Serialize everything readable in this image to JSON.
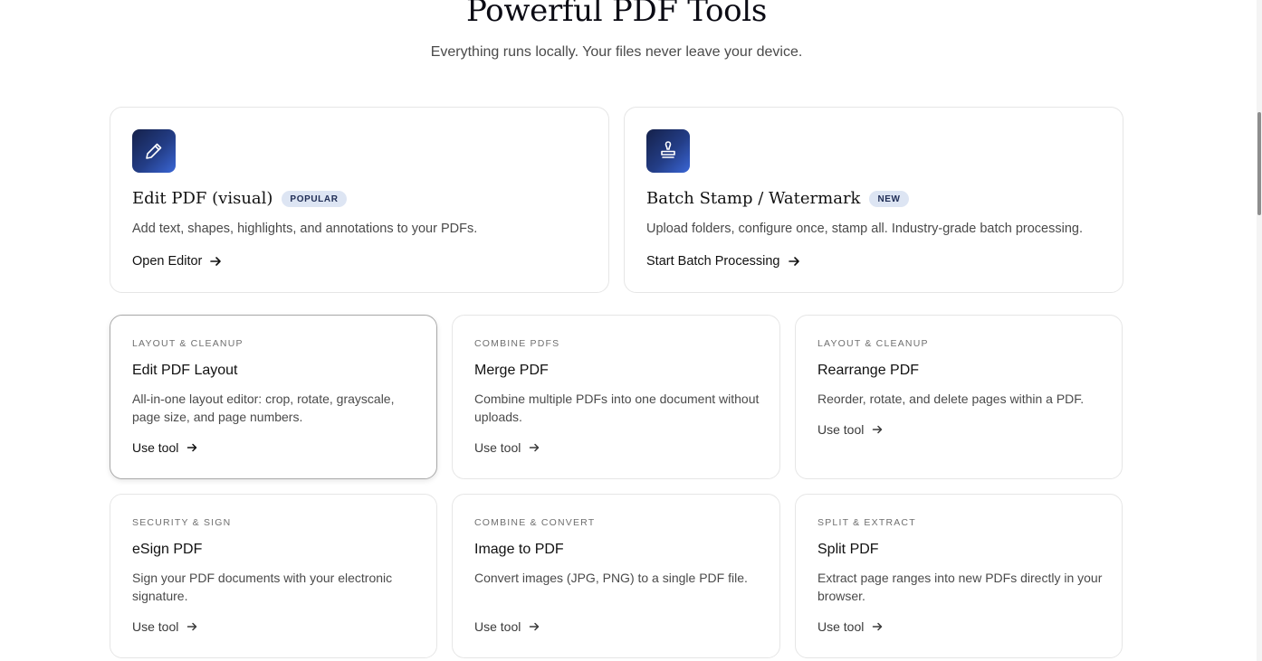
{
  "hero": {
    "title": "Powerful PDF Tools",
    "subtitle": "Everything runs locally. Your files never leave your device."
  },
  "featured": [
    {
      "icon": "pencil-icon",
      "title": "Edit PDF (visual)",
      "badge": "POPULAR",
      "description": "Add text, shapes, highlights, and annotations to your PDFs.",
      "cta": "Open Editor"
    },
    {
      "icon": "stamp-icon",
      "title": "Batch Stamp / Watermark",
      "badge": "NEW",
      "description": "Upload folders, configure once, stamp all. Industry-grade batch processing.",
      "cta": "Start Batch Processing"
    }
  ],
  "tools": [
    {
      "category": "LAYOUT & CLEANUP",
      "title": "Edit PDF Layout",
      "description": "All-in-one layout editor: crop, rotate, grayscale, page size, and page numbers.",
      "cta": "Use tool"
    },
    {
      "category": "COMBINE PDFS",
      "title": "Merge PDF",
      "description": "Combine multiple PDFs into one document without uploads.",
      "cta": "Use tool"
    },
    {
      "category": "LAYOUT & CLEANUP",
      "title": "Rearrange PDF",
      "description": "Reorder, rotate, and delete pages within a PDF.",
      "cta": "Use tool"
    },
    {
      "category": "SECURITY & SIGN",
      "title": "eSign PDF",
      "description": "Sign your PDF documents with your electronic signature.",
      "cta": "Use tool"
    },
    {
      "category": "COMBINE & CONVERT",
      "title": "Image to PDF",
      "description": "Convert images (JPG, PNG) to a single PDF file.",
      "cta": "Use tool"
    },
    {
      "category": "SPLIT & EXTRACT",
      "title": "Split PDF",
      "description": "Extract page ranges into new PDFs directly in your browser.",
      "cta": "Use tool"
    }
  ],
  "colors": {
    "icon_gradient_start": "#15214a",
    "icon_gradient_end": "#3a66d6",
    "badge_bg": "#dde5f3",
    "card_border": "#e6e6e6"
  }
}
